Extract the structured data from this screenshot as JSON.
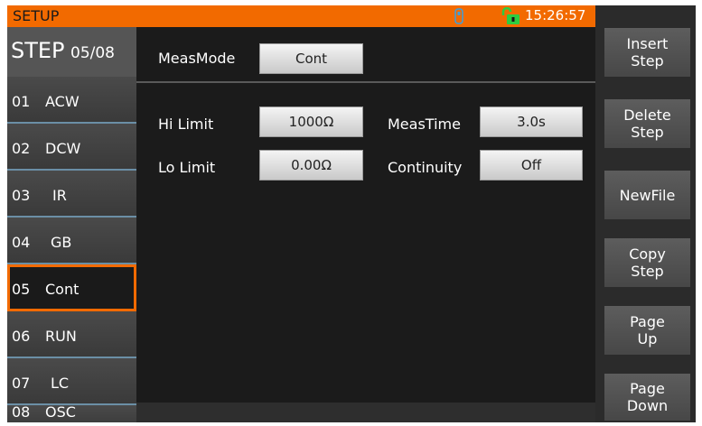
{
  "colors": {
    "accent": "#f26a00",
    "background": "#1b1b1b",
    "panel": "#4a4a4a"
  },
  "topbar": {
    "title": "SETUP",
    "time": "15:26:57",
    "icons": [
      "usb-icon",
      "unlock-icon"
    ]
  },
  "step_header": {
    "label": "STEP",
    "position": "05/08"
  },
  "steps": [
    {
      "num": "01",
      "name": "ACW"
    },
    {
      "num": "02",
      "name": "DCW"
    },
    {
      "num": "03",
      "name": "IR"
    },
    {
      "num": "04",
      "name": "GB"
    },
    {
      "num": "05",
      "name": "Cont",
      "selected": true
    },
    {
      "num": "06",
      "name": "RUN"
    },
    {
      "num": "07",
      "name": "LC"
    },
    {
      "num": "08",
      "name": "OSC"
    }
  ],
  "main": {
    "meas_mode_label": "MeasMode",
    "meas_mode_value": "Cont",
    "hi_limit_label": "Hi Limit",
    "hi_limit_value": "1000Ω",
    "lo_limit_label": "Lo Limit",
    "lo_limit_value": "0.00Ω",
    "meas_time_label": "MeasTime",
    "meas_time_value": "3.0s",
    "continuity_label": "Continuity",
    "continuity_value": "Off"
  },
  "softkeys": [
    {
      "line1": "Insert",
      "line2": "Step"
    },
    {
      "line1": "Delete",
      "line2": "Step"
    },
    {
      "line1": "NewFile",
      "line2": ""
    },
    {
      "line1": "Copy",
      "line2": "Step"
    },
    {
      "line1": "Page",
      "line2": "Up"
    },
    {
      "line1": "Page",
      "line2": "Down"
    }
  ]
}
